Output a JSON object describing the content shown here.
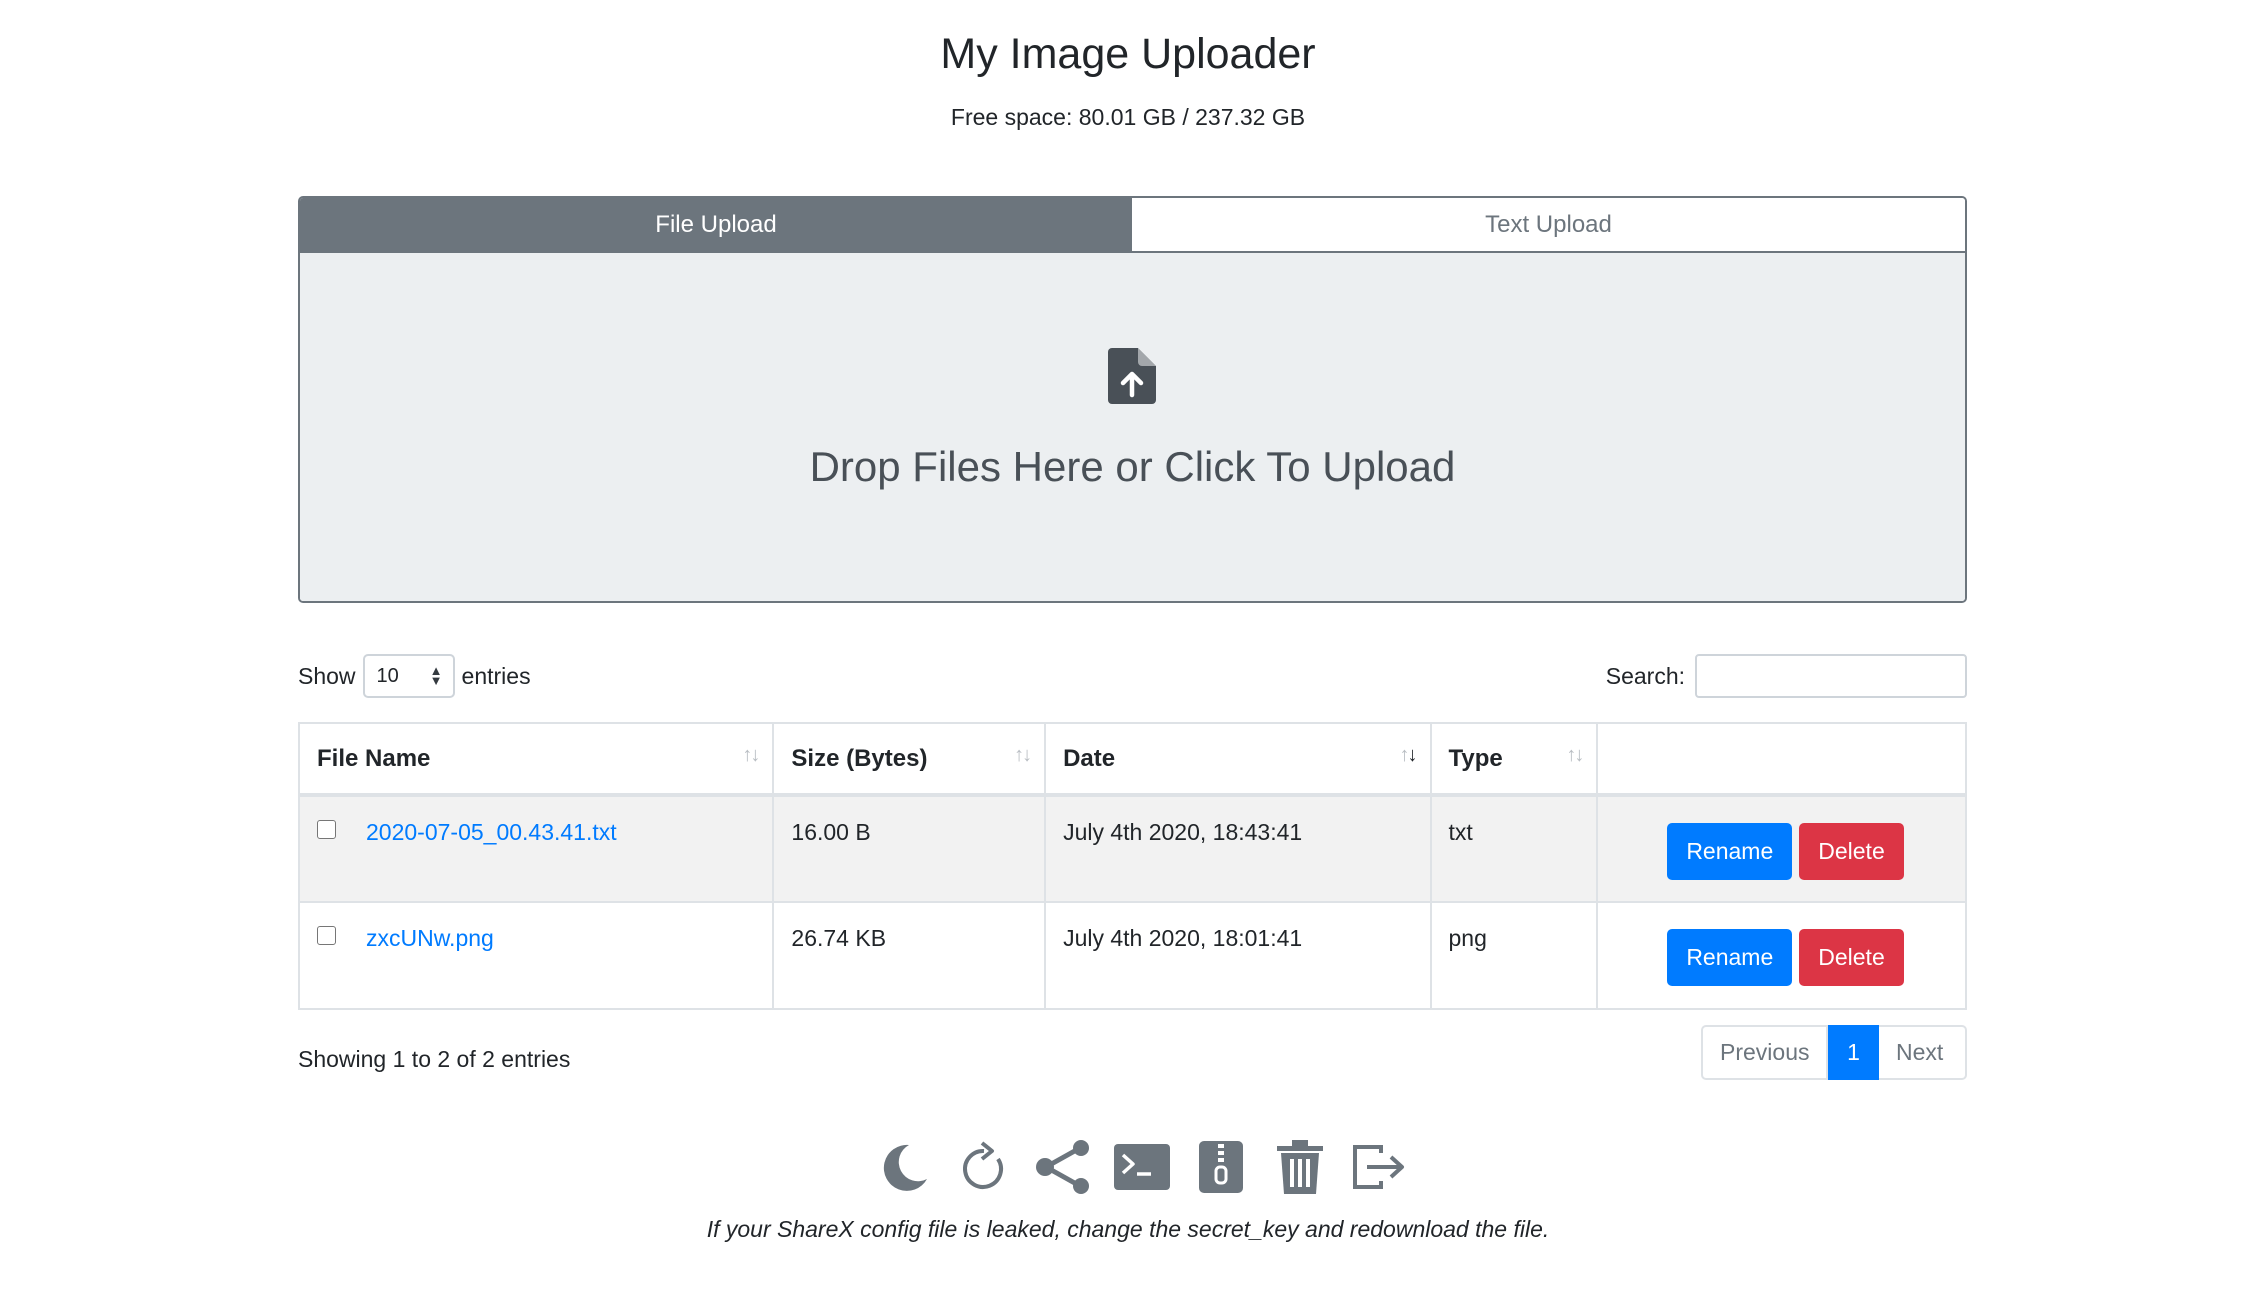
{
  "header": {
    "title": "My Image Uploader",
    "free_space": "Free space: 80.01 GB / 237.32 GB"
  },
  "upload": {
    "tabs": [
      {
        "label": "File Upload",
        "active": true
      },
      {
        "label": "Text Upload",
        "active": false
      }
    ],
    "drop_text": "Drop Files Here or Click To Upload",
    "icon": "file-upload-icon"
  },
  "table_controls": {
    "show_label": "Show",
    "page_size": "10",
    "entries_label": "entries",
    "search_label": "Search:",
    "search_value": ""
  },
  "table": {
    "columns": [
      "File Name",
      "Size (Bytes)",
      "Date",
      "Type",
      ""
    ],
    "sorted_column": "Date",
    "rows": [
      {
        "name": "2020-07-05_00.43.41.txt",
        "size": "16.00 B",
        "date": "July 4th 2020, 18:43:41",
        "type": "txt",
        "rename": "Rename",
        "delete": "Delete"
      },
      {
        "name": "zxcUNw.png",
        "size": "26.74 KB",
        "date": "July 4th 2020, 18:01:41",
        "type": "png",
        "rename": "Rename",
        "delete": "Delete"
      }
    ]
  },
  "footer": {
    "info": "Showing 1 to 2 of 2 entries",
    "pagination": {
      "previous": "Previous",
      "current": "1",
      "next": "Next"
    },
    "tools": [
      "moon-icon",
      "refresh-icon",
      "share-icon",
      "terminal-icon",
      "zip-file-icon",
      "trash-icon",
      "logout-icon"
    ],
    "note": "If your ShareX config file is leaked, change the secret_key and redownload the file."
  },
  "colors": {
    "primary": "#007bff",
    "danger": "#dc3545",
    "secondary": "#6c757d",
    "dropzone_bg": "#eceff1"
  }
}
